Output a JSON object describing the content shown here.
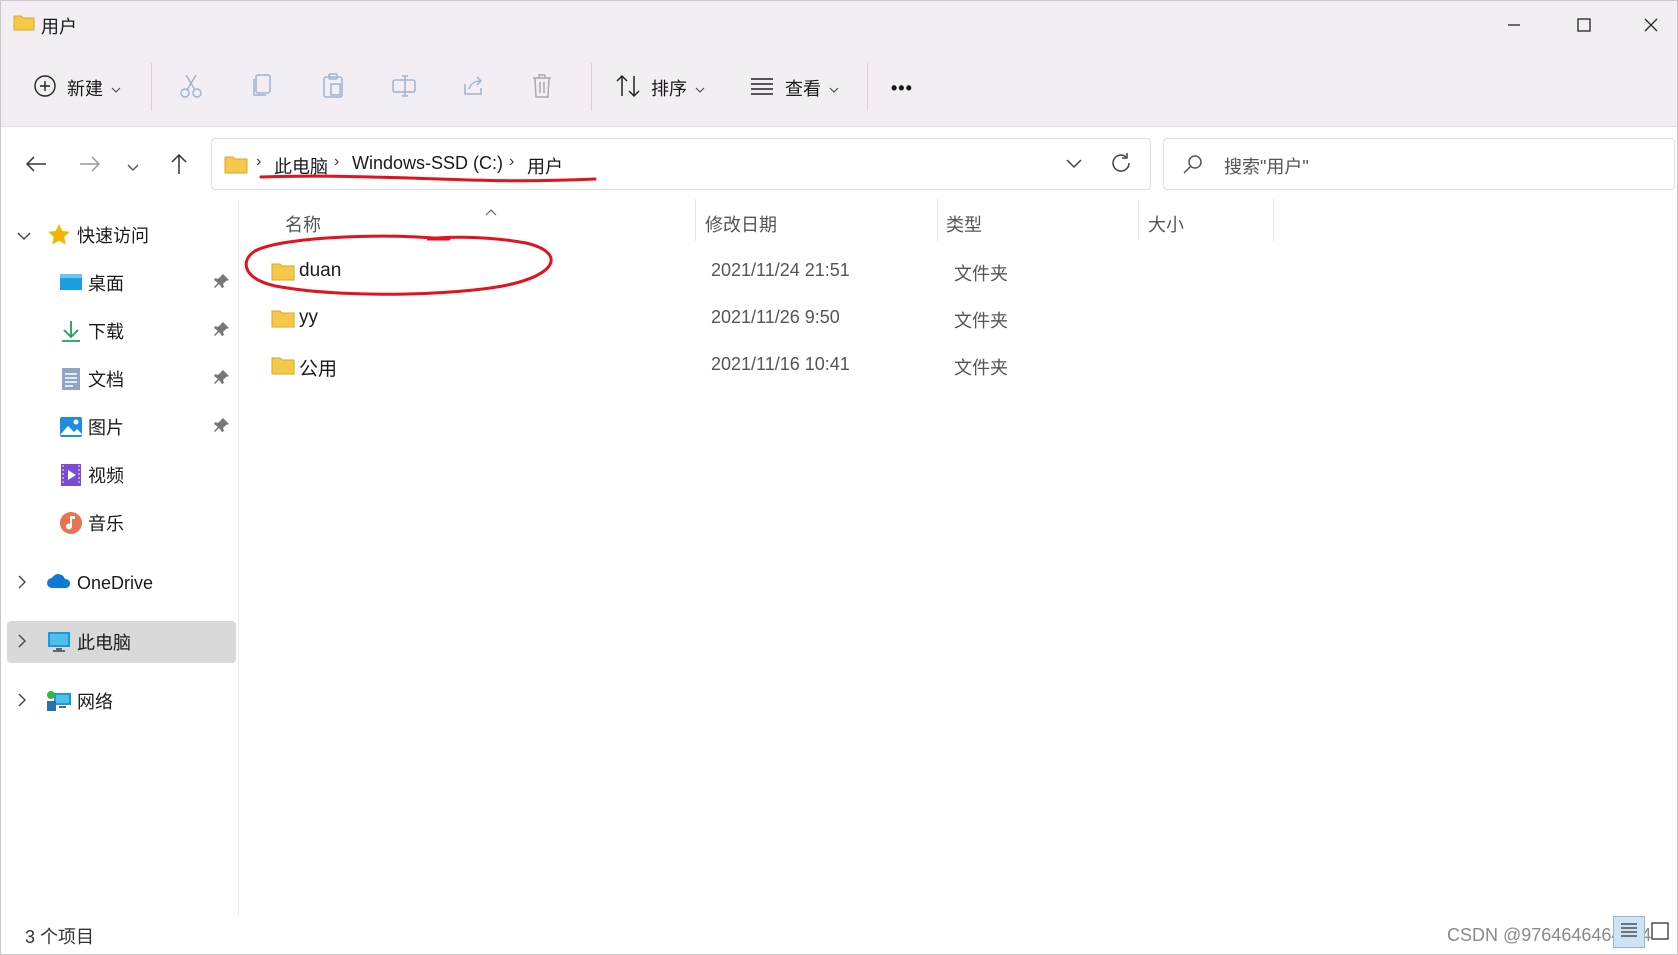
{
  "window": {
    "title": "用户",
    "minimize_glyph": "—",
    "maximize_glyph": "☐",
    "close_glyph": "✕"
  },
  "toolbar": {
    "new_label": "新建",
    "sort_label": "排序",
    "view_label": "查看",
    "more_label": "•••",
    "icons": [
      "plus-circle-icon",
      "cut-icon",
      "copy-icon",
      "paste-icon",
      "rename-icon",
      "share-icon",
      "delete-icon",
      "sort-icon",
      "view-icon",
      "more-icon"
    ]
  },
  "address": {
    "crumbs": [
      "此电脑",
      "Windows-SSD (C:)",
      "用户"
    ],
    "separator": "›",
    "annotation_color": "#e0141e"
  },
  "search": {
    "placeholder": "搜索\"用户\""
  },
  "sidebar": {
    "quick_access": "快速访问",
    "items": [
      {
        "label": "桌面",
        "icon": "desktop-icon",
        "pinned": true
      },
      {
        "label": "下载",
        "icon": "download-icon",
        "pinned": true
      },
      {
        "label": "文档",
        "icon": "document-icon",
        "pinned": true
      },
      {
        "label": "图片",
        "icon": "pictures-icon",
        "pinned": true
      },
      {
        "label": "视频",
        "icon": "video-icon",
        "pinned": false
      },
      {
        "label": "音乐",
        "icon": "music-icon",
        "pinned": false
      }
    ],
    "onedrive": "OneDrive",
    "this_pc": "此电脑",
    "network": "网络"
  },
  "columns": {
    "name": "名称",
    "modified": "修改日期",
    "type": "类型",
    "size": "大小"
  },
  "files": [
    {
      "name": "duan",
      "modified": "2021/11/24 21:51",
      "type": "文件夹",
      "size": ""
    },
    {
      "name": "yy",
      "modified": "2021/11/26 9:50",
      "type": "文件夹",
      "size": ""
    },
    {
      "name": "公用",
      "modified": "2021/11/16 10:41",
      "type": "文件夹",
      "size": ""
    }
  ],
  "status": {
    "count": "3 个项目",
    "watermark": "CSDN @9764646464454"
  },
  "colors": {
    "chrome_bg": "#f3eef3",
    "folder_yellow": "#f7c948",
    "selected_bg": "#d9d9d9",
    "annotation_red": "#e0141e"
  }
}
